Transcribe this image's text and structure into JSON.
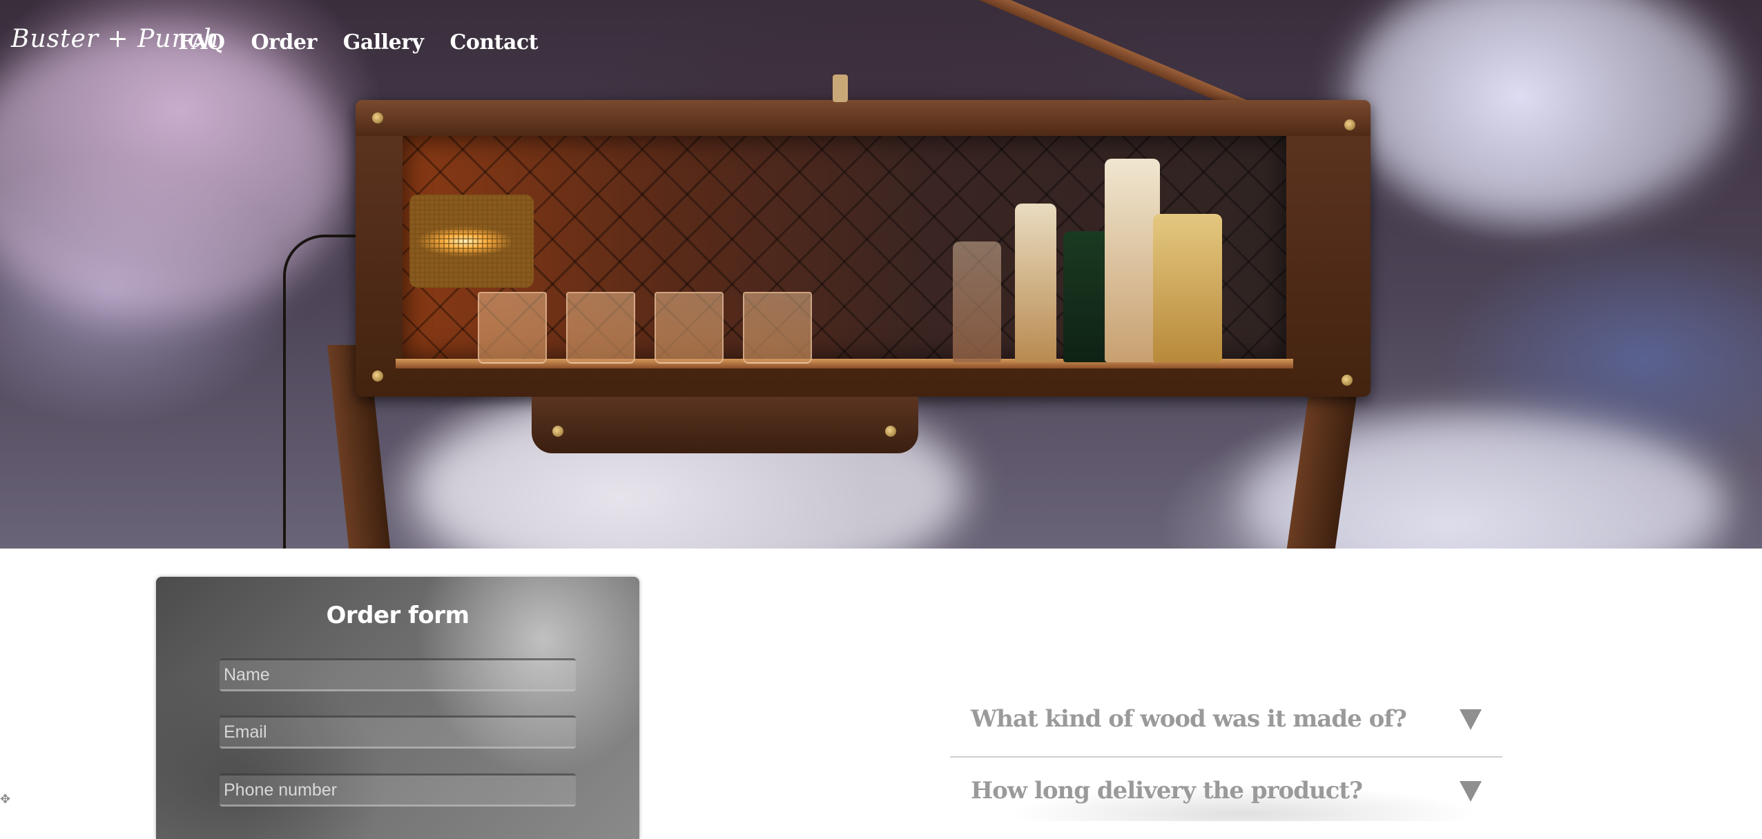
{
  "brand": {
    "logo_text": "Buster + Punch"
  },
  "nav": {
    "items": [
      {
        "label": "FAQ"
      },
      {
        "label": "Order"
      },
      {
        "label": "Gallery"
      },
      {
        "label": "Contact"
      }
    ]
  },
  "hero": {
    "image_icon": "liquor-cabinet-hero-image"
  },
  "order_form": {
    "title": "Order form",
    "fields": {
      "name_placeholder": "Name",
      "email_placeholder": "Email",
      "phone_placeholder": "Phone number"
    }
  },
  "faq": {
    "items": [
      {
        "question": "What kind of wood was it made of?"
      },
      {
        "question": "How long delivery the product?"
      }
    ]
  },
  "colors": {
    "nav_text": "#ffffff",
    "faq_text": "#9a9a9a",
    "form_bg": "#6b6b6b"
  }
}
